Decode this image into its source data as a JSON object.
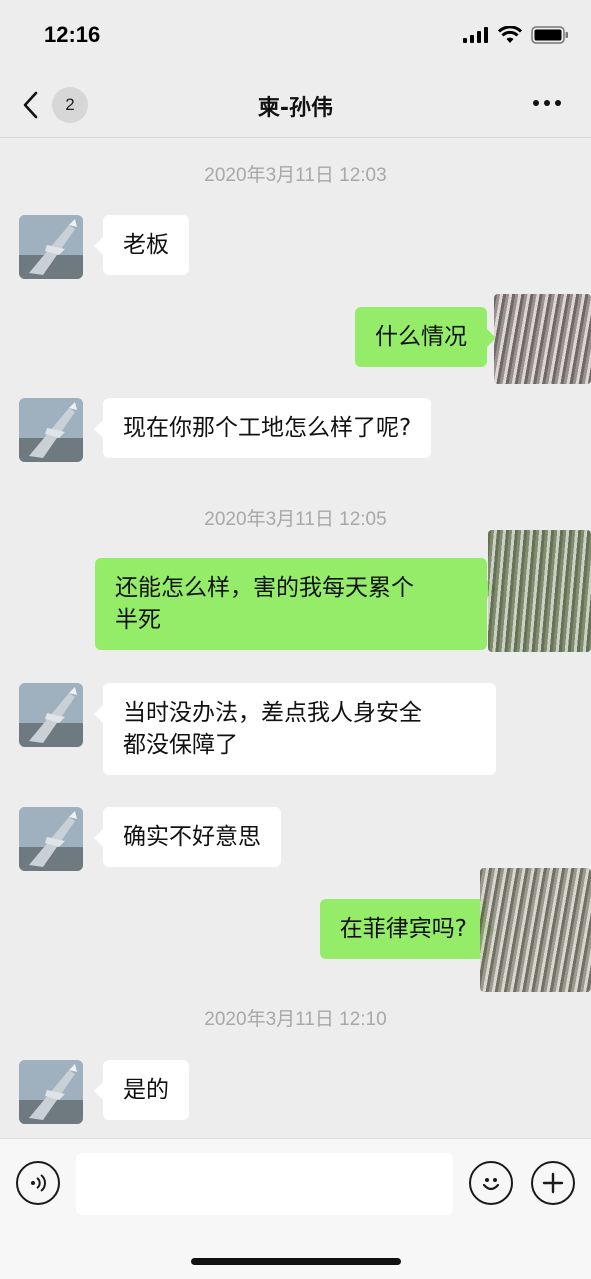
{
  "status": {
    "time": "12:16"
  },
  "header": {
    "title": "柬-孙伟",
    "unread_count": "2"
  },
  "messages": [
    {
      "type": "time",
      "text": "2020年3月11日 12:03"
    },
    {
      "type": "in",
      "text": "老板"
    },
    {
      "type": "out",
      "text": "什么情况"
    },
    {
      "type": "in",
      "text": "现在你那个工地怎么样了呢?"
    },
    {
      "type": "time",
      "text": "2020年3月11日 12:05"
    },
    {
      "type": "out",
      "line1": "还能怎么样，害的我每天累个",
      "line2": "半死"
    },
    {
      "type": "in",
      "line1": "当时没办法，差点我人身安全",
      "line2": "都没保障了"
    },
    {
      "type": "in",
      "text": "确实不好意思"
    },
    {
      "type": "out",
      "text": "在菲律宾吗?"
    },
    {
      "type": "time",
      "text": "2020年3月11日 12:10"
    },
    {
      "type": "in",
      "text": "是的"
    }
  ],
  "input": {
    "value": ""
  },
  "icons": {
    "back": "chevron-left-icon",
    "more": "more-dots-icon",
    "voice": "voice-icon",
    "emoji": "emoji-icon",
    "plus": "plus-icon"
  },
  "colors": {
    "outgoing_bubble": "#95ec69",
    "incoming_bubble": "#ffffff",
    "background": "#ededed"
  }
}
